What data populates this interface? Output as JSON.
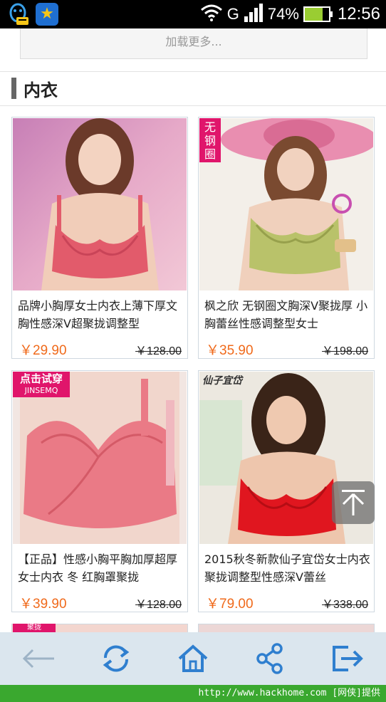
{
  "status_bar": {
    "network": "G",
    "battery_pct": "74%",
    "battery_level": 0.74,
    "time": "12:56",
    "icons": [
      "qq-icon",
      "star-app-icon",
      "wifi-icon",
      "signal-icon",
      "battery-icon"
    ]
  },
  "load_more": {
    "label": "加载更多..."
  },
  "section": {
    "title": "内衣"
  },
  "products": [
    {
      "title": "品牌小胸厚女士内衣上薄下厚文胸性感深V超聚拢调整型",
      "price": "￥29.90",
      "orig_price": "￥128.00",
      "badge": ""
    },
    {
      "title": "枫之欣 无钢圈文胸深V聚拢厚 小胸蕾丝性感调整型女士",
      "price": "￥35.90",
      "orig_price": "￥198.00",
      "badge": "无钢圈"
    },
    {
      "title": "【正品】性感小胸平胸加厚超厚女士内衣 冬 红胸罩聚拢",
      "price": "￥39.90",
      "orig_price": "￥128.00",
      "badge": "点击试穿 JINSEMQ"
    },
    {
      "title": "2015秋冬新款仙子宜岱女士内衣聚拢调整型性感深V蕾丝",
      "price": "￥79.00",
      "orig_price": "￥338.00",
      "badge": "仙子宜岱"
    }
  ],
  "badges": {
    "wugangquan_l1": "无",
    "wugangquan_l2": "钢",
    "wugangquan_l3": "圈",
    "tryon_l1": "点击试穿",
    "tryon_l2": "JINSEMQ",
    "brand": "仙子宜岱",
    "partial_left": "聚拢"
  },
  "bottom_nav": [
    "back-icon",
    "refresh-icon",
    "home-icon",
    "share-icon",
    "exit-icon"
  ],
  "footer": {
    "text": "http://www.hackhome.com [网侠]提供"
  },
  "colors": {
    "price": "#f06a1b",
    "nav_icon": "#2f7fcf",
    "nav_bg": "#dbe6ee",
    "footer_bg": "#3aa82f"
  }
}
